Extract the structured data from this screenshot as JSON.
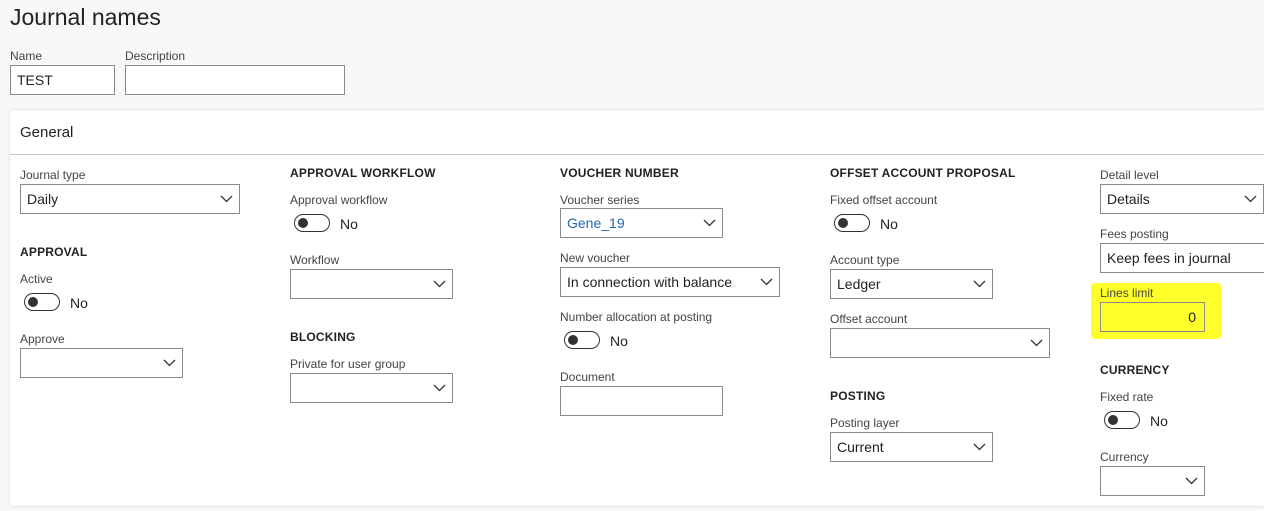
{
  "page": {
    "title": "Journal names"
  },
  "header_fields": {
    "name": {
      "label": "Name",
      "value": "TEST"
    },
    "description": {
      "label": "Description",
      "value": ""
    }
  },
  "general": {
    "title": "General",
    "journal_type": {
      "label": "Journal type",
      "value": "Daily"
    },
    "approval": {
      "heading": "APPROVAL",
      "active": {
        "label": "Active",
        "value": "No"
      },
      "approve": {
        "label": "Approve",
        "value": ""
      }
    },
    "approval_workflow": {
      "heading": "APPROVAL WORKFLOW",
      "approval_workflow": {
        "label": "Approval workflow",
        "value": "No"
      },
      "workflow": {
        "label": "Workflow",
        "value": ""
      }
    },
    "blocking": {
      "heading": "BLOCKING",
      "private_for_user_group": {
        "label": "Private for user group",
        "value": ""
      }
    },
    "voucher_number": {
      "heading": "VOUCHER NUMBER",
      "voucher_series": {
        "label": "Voucher series",
        "value": "Gene_19"
      },
      "new_voucher": {
        "label": "New voucher",
        "value": "In connection with balance"
      },
      "number_allocation": {
        "label": "Number allocation at posting",
        "value": "No"
      },
      "document": {
        "label": "Document",
        "value": ""
      }
    },
    "offset_account_proposal": {
      "heading": "OFFSET ACCOUNT PROPOSAL",
      "fixed_offset_account": {
        "label": "Fixed offset account",
        "value": "No"
      },
      "account_type": {
        "label": "Account type",
        "value": "Ledger"
      },
      "offset_account": {
        "label": "Offset account",
        "value": ""
      }
    },
    "posting": {
      "heading": "POSTING",
      "posting_layer": {
        "label": "Posting layer",
        "value": "Current"
      }
    },
    "detail_level": {
      "label": "Detail level",
      "value": "Details"
    },
    "fees_posting": {
      "label": "Fees posting",
      "value": "Keep fees in journal"
    },
    "lines_limit": {
      "label": "Lines limit",
      "value": "0"
    },
    "currency_section": {
      "heading": "CURRENCY",
      "fixed_rate": {
        "label": "Fixed rate",
        "value": "No"
      },
      "currency": {
        "label": "Currency",
        "value": ""
      }
    }
  },
  "colors": {
    "highlight": "#ffff2a",
    "link": "#2266b3",
    "border": "#8a8a8a"
  },
  "icons": {
    "dropdown": "chevron-down-icon"
  }
}
